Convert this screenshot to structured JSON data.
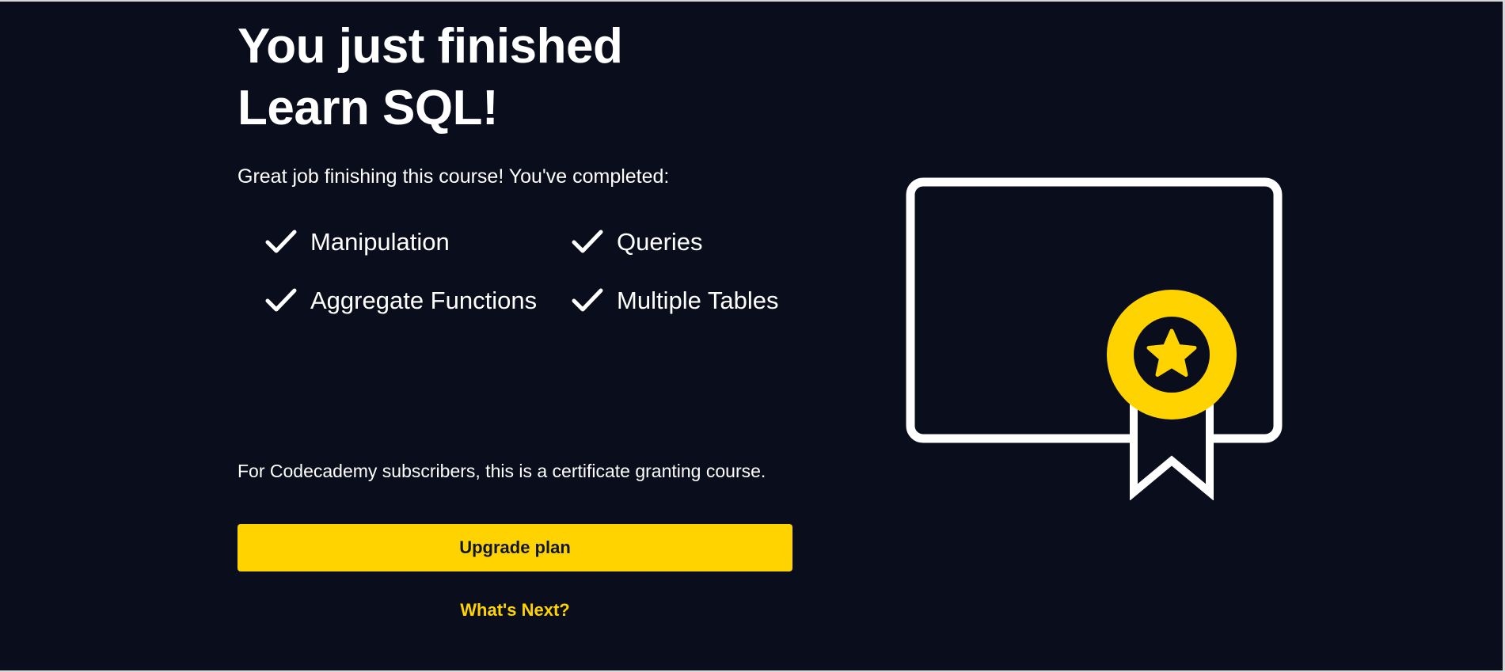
{
  "header": {
    "title_line1": "You just finished",
    "title_line2": "Learn SQL!"
  },
  "subtitle": "Great job finishing this course! You've completed:",
  "modules": [
    {
      "label": "Manipulation",
      "icon": "check-icon"
    },
    {
      "label": "Queries",
      "icon": "check-icon"
    },
    {
      "label": "Aggregate Functions",
      "icon": "check-icon"
    },
    {
      "label": "Multiple Tables",
      "icon": "check-icon"
    }
  ],
  "certificate_note": "For Codecademy subscribers, this is a certificate granting course.",
  "actions": {
    "upgrade_label": "Upgrade plan",
    "next_label": "What's Next?"
  },
  "illustration": {
    "icon": "certificate-icon",
    "badge_icon": "star-badge-icon"
  },
  "colors": {
    "background": "#0A0D1C",
    "accent": "#FFD300",
    "text": "#FFFFFF",
    "button_text": "#10162F"
  }
}
